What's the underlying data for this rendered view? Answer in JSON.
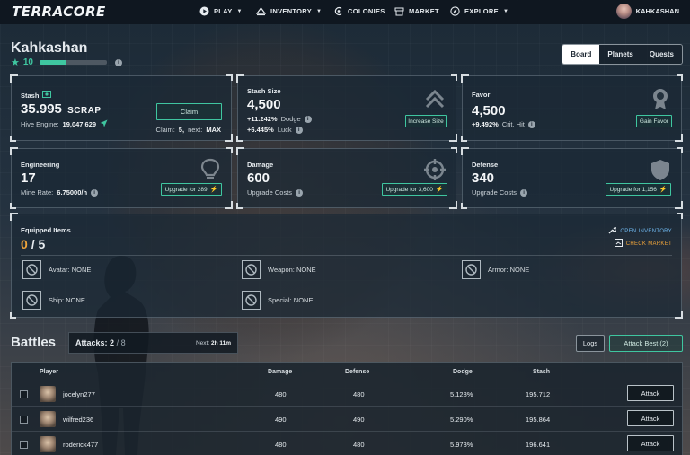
{
  "app": {
    "logo": "TERRACORE"
  },
  "nav": {
    "items": [
      {
        "label": "PLAY",
        "icon": "play-icon",
        "has_caret": true
      },
      {
        "label": "INVENTORY",
        "icon": "inventory-icon",
        "has_caret": true
      },
      {
        "label": "COLONIES",
        "icon": "colonies-icon",
        "has_caret": false
      },
      {
        "label": "MARKET",
        "icon": "market-icon",
        "has_caret": false
      },
      {
        "label": "EXPLORE",
        "icon": "explore-icon",
        "has_caret": true
      }
    ],
    "user": "KAHKASHAN"
  },
  "profile": {
    "name": "Kahkashan",
    "level": "10",
    "xp_fraction": 0.4
  },
  "tabs": [
    {
      "label": "Board",
      "active": true
    },
    {
      "label": "Planets",
      "active": false
    },
    {
      "label": "Quests",
      "active": false
    }
  ],
  "stash": {
    "label": "Stash",
    "value": "35.995",
    "unit": "SCRAP",
    "hive_label": "Hive Engine:",
    "hive_value": "19,047.629",
    "claim_button": "Claim",
    "claim_label": "Claim:",
    "claim_value": "5,",
    "next_label": "next:",
    "next_value": "MAX"
  },
  "stash_size": {
    "label": "Stash Size",
    "value": "4,500",
    "dodge_value": "+11.242%",
    "dodge_label": "Dodge",
    "luck_value": "+6.445%",
    "luck_label": "Luck",
    "button": "Increase Size"
  },
  "favor": {
    "label": "Favor",
    "value": "4,500",
    "crit_value": "+9.492%",
    "crit_label": "Crit. Hit",
    "button": "Gain Favor"
  },
  "engineering": {
    "label": "Engineering",
    "value": "17",
    "rate_label": "Mine Rate:",
    "rate_value": "6.75000/h",
    "button": "Upgrade for 289"
  },
  "damage": {
    "label": "Damage",
    "value": "600",
    "sub": "Upgrade Costs",
    "button": "Upgrade for 3,600"
  },
  "defense": {
    "label": "Defense",
    "value": "340",
    "sub": "Upgrade Costs",
    "button": "Upgrade for 1,156"
  },
  "equipped": {
    "title": "Equipped Items",
    "count": "0",
    "total": "/ 5",
    "open_inventory": "OPEN INVENTORY",
    "check_market": "CHECK MARKET",
    "slots": [
      {
        "label": "Avatar:",
        "value": "NONE"
      },
      {
        "label": "Weapon:",
        "value": "NONE"
      },
      {
        "label": "Armor:",
        "value": "NONE"
      },
      {
        "label": "Ship:",
        "value": "NONE"
      },
      {
        "label": "Special:",
        "value": "NONE"
      }
    ]
  },
  "battles": {
    "title": "Battles",
    "attacks_label": "Attacks:",
    "attacks_value": "2",
    "attacks_total": "/ 8",
    "next_label": "Next:",
    "next_value": "2h 11m",
    "logs_button": "Logs",
    "attack_best_button": "Attack Best (2)",
    "columns": [
      "Player",
      "Damage",
      "Defense",
      "Dodge",
      "Stash"
    ],
    "rows": [
      {
        "player": "jocelyn277",
        "damage": "480",
        "defense": "480",
        "dodge": "5.128%",
        "stash": "195.712",
        "action": "Attack"
      },
      {
        "player": "wilfred236",
        "damage": "490",
        "defense": "490",
        "dodge": "5.290%",
        "stash": "195.864",
        "action": "Attack"
      },
      {
        "player": "roderick477",
        "damage": "480",
        "defense": "480",
        "dodge": "5.973%",
        "stash": "196.641",
        "action": "Attack"
      }
    ]
  },
  "colors": {
    "accent_green": "#3fc6a0",
    "accent_orange": "#f0a53a",
    "accent_blue": "#6fb8f0"
  }
}
